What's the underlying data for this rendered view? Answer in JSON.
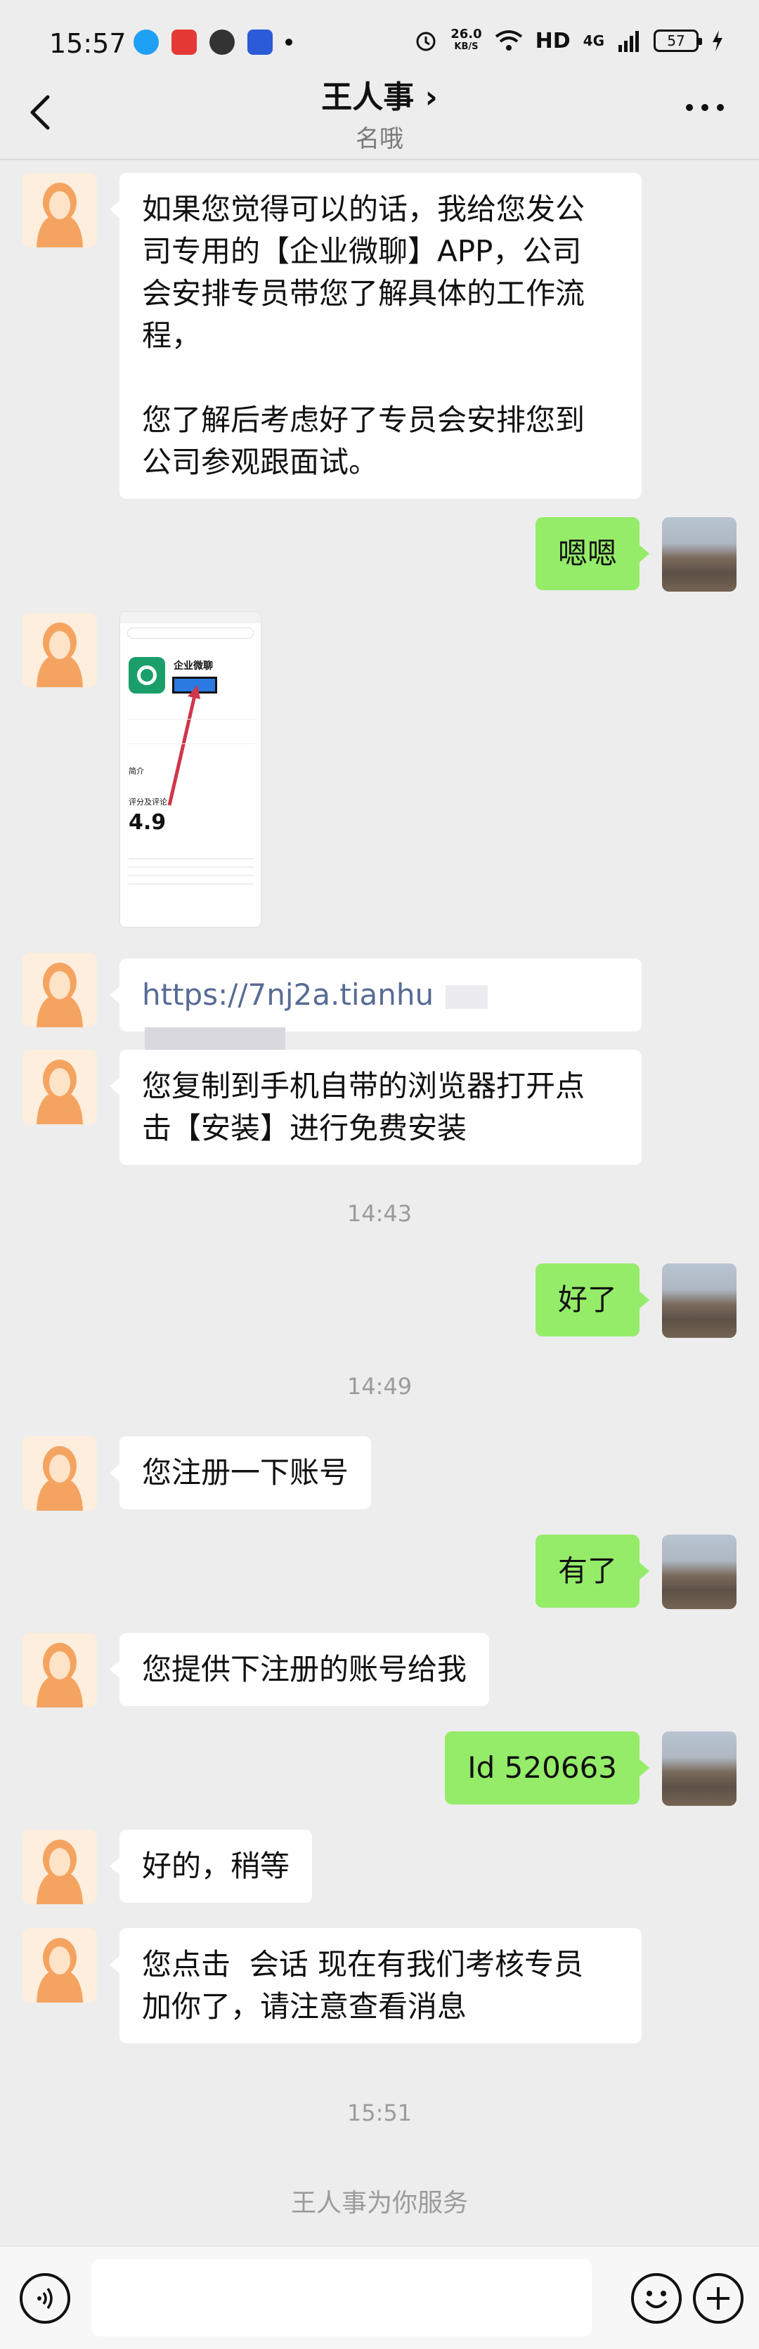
{
  "status_bar": {
    "time": "15:57",
    "net_speed_value": "26.0",
    "net_speed_unit": "KB/S",
    "hd_label": "HD",
    "signal_label": "4G",
    "battery_level": "57"
  },
  "header": {
    "title": "王人事 ›",
    "subtitle": "名哦"
  },
  "messages": [
    {
      "side": "left",
      "lines": [
        "如果您觉得可以的话，我给您发公",
        "司专用的【企业微聊】APP，公司",
        "会安排专员带您了解具体的工作流",
        "程，",
        "",
        "您了解后考虑好了专员会安排您到",
        "公司参观跟面试。"
      ]
    },
    {
      "side": "right",
      "text": "嗯嗯"
    },
    {
      "side": "left",
      "type": "image",
      "image": {
        "app_name": "企业微聊",
        "rating": "4.9",
        "section_intro": "简介",
        "section_rating": "评分及评论"
      }
    },
    {
      "side": "left",
      "type": "link",
      "text": "https://7nj2a.tianhu"
    },
    {
      "side": "left",
      "lines": [
        "您复制到手机自带的浏览器打开点",
        "击【安装】进行免费安装"
      ]
    },
    {
      "side": "right",
      "text": "好了"
    },
    {
      "side": "left",
      "text": "您注册一下账号"
    },
    {
      "side": "right",
      "text": "有了"
    },
    {
      "side": "left",
      "text": "您提供下注册的账号给我"
    },
    {
      "side": "right",
      "text": "Id 520663"
    },
    {
      "side": "left",
      "text": "好的，稍等"
    },
    {
      "side": "left",
      "lines": [
        "您点击  会话 现在有我们考核专员",
        "加你了，请注意查看消息"
      ]
    }
  ],
  "timestamps": [
    "14:43",
    "14:49",
    "15:51"
  ],
  "footer_note": "王人事为你服务",
  "input": {
    "placeholder": ""
  },
  "colors": {
    "background": "#ededed",
    "bubble_white": "#ffffff",
    "bubble_green": "#95ec69",
    "link": "#576b95",
    "timestamp": "#9b9b9b"
  },
  "icons": [
    "back-arrow-icon",
    "more-icon",
    "voice-icon",
    "emoji-icon",
    "plus-icon"
  ]
}
